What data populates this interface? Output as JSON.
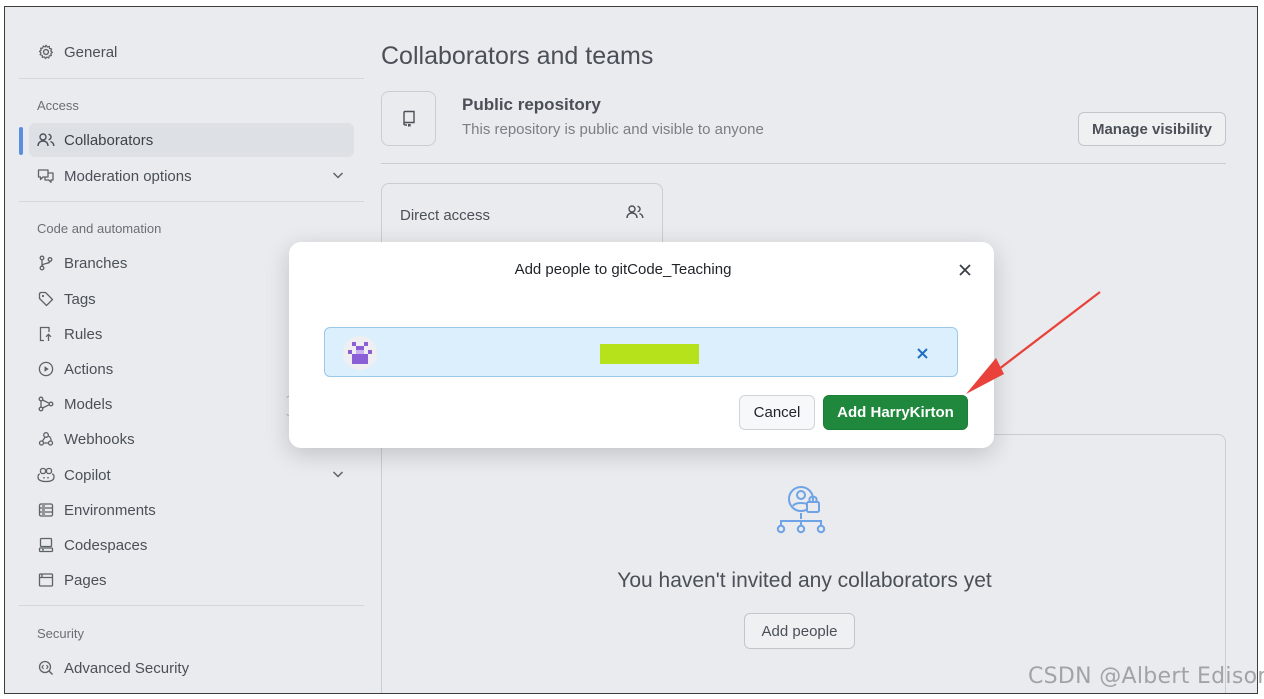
{
  "sidebar": {
    "general": "General",
    "sections": {
      "access": "Access",
      "code_automation": "Code and automation",
      "security": "Security"
    },
    "access_items": [
      {
        "label": "Collaborators",
        "icon": "people-icon",
        "active": true
      },
      {
        "label": "Moderation options",
        "icon": "comment-discussion-icon",
        "expandable": true
      }
    ],
    "code_items": [
      {
        "label": "Branches",
        "icon": "git-branch-icon"
      },
      {
        "label": "Tags",
        "icon": "tag-icon"
      },
      {
        "label": "Rules",
        "icon": "repo-push-icon"
      },
      {
        "label": "Actions",
        "icon": "play-icon"
      },
      {
        "label": "Models",
        "icon": "models-icon"
      },
      {
        "label": "Webhooks",
        "icon": "webhook-icon"
      },
      {
        "label": "Copilot",
        "icon": "copilot-icon",
        "expandable": true
      },
      {
        "label": "Environments",
        "icon": "server-icon"
      },
      {
        "label": "Codespaces",
        "icon": "codespaces-icon"
      },
      {
        "label": "Pages",
        "icon": "browser-icon"
      }
    ],
    "security_items": [
      {
        "label": "Advanced Security",
        "icon": "codescan-icon"
      }
    ]
  },
  "main": {
    "title": "Collaborators and teams",
    "visibility": {
      "title": "Public repository",
      "subtitle": "This repository is public and visible to anyone",
      "button": "Manage visibility"
    },
    "direct_access": {
      "title": "Direct access"
    },
    "empty_state": {
      "title": "You haven't invited any collaborators yet",
      "button": "Add people"
    }
  },
  "modal": {
    "title": "Add people to gitCode_Teaching",
    "cancel": "Cancel",
    "confirm": "Add HarryKirton"
  },
  "annotation": {
    "color": "#e8423a"
  },
  "watermark": "CSDN @Albert Edison",
  "colors": {
    "primary_green": "#1f883d",
    "accent_blue": "#5a8fe0",
    "chip_bg": "#dbeffc",
    "redaction": "#b5e21a"
  }
}
